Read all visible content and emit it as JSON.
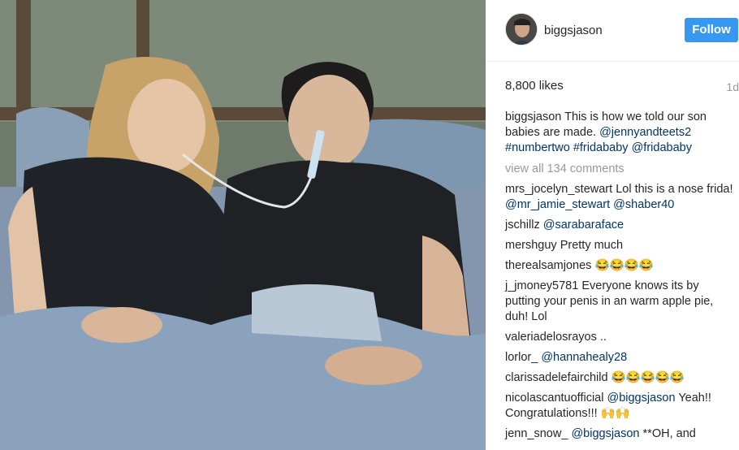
{
  "post": {
    "username": "biggsjason",
    "follow_label": "Follow",
    "likes": "8,800 likes",
    "time_ago": "1d",
    "caption": {
      "user": "biggsjason",
      "text": "This is how we told our son babies are made.",
      "mention1": "@jennyandteets2",
      "tag1": "#numbertwo",
      "tag2": "#fridababy",
      "mention2": "@fridababy"
    },
    "view_all": "view all 134 comments"
  },
  "comments": [
    {
      "user": "mrs_jocelyn_stewart",
      "text": "Lol this is a nose frida!",
      "mention": "@mr_jamie_stewart",
      "mention2": "@shaber40"
    },
    {
      "user": "jschillz",
      "mention": "@sarabaraface"
    },
    {
      "user": "mershguy",
      "text": "Pretty much"
    },
    {
      "user": "therealsamjones",
      "text": "😂😂😂😂"
    },
    {
      "user": "j_jmoney5781",
      "text": "Everyone knows its by putting your penis in an warm apple pie, duh! Lol"
    },
    {
      "user": "valeriadelosrayos",
      "text": ".."
    },
    {
      "user": "lorlor_",
      "mention": "@hannahealy28"
    },
    {
      "user": "clarissadelefairchild",
      "text": "😂😂😂😂😂"
    },
    {
      "user": "nicolascantuofficial",
      "mention": "@biggsjason",
      "text": "Yeah!! Congratulations!!! 🙌🙌"
    },
    {
      "user": "jenn_snow_",
      "mention": "@biggsjason",
      "text": "**OH, and"
    }
  ],
  "colors": {
    "follow_bg": "#3897f0",
    "mention": "#003569",
    "muted": "#999999"
  },
  "icons": {
    "avatar": "profile-photo",
    "photo": "post-photo"
  }
}
